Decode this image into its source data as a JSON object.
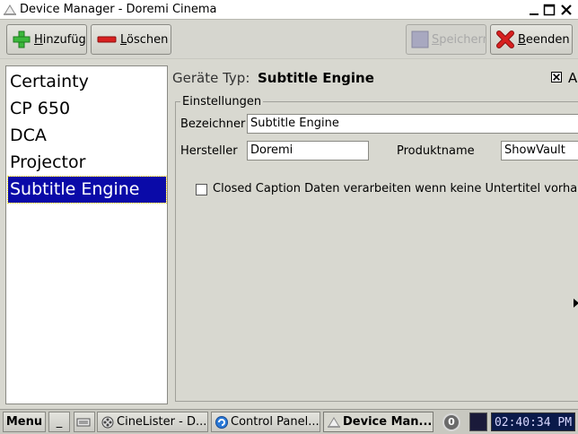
{
  "window": {
    "title": "Device Manager - Doremi Cinema"
  },
  "toolbar": {
    "add": {
      "prefix": "",
      "accel": "H",
      "rest": "inzufügen"
    },
    "delete": {
      "prefix": "",
      "accel": "L",
      "rest": "öschen"
    },
    "save": {
      "prefix": "",
      "accel": "S",
      "rest": "peichern"
    },
    "quit": {
      "prefix": "",
      "accel": "B",
      "rest": "eenden"
    }
  },
  "devices": {
    "items": [
      "Certainty",
      "CP 650",
      "DCA",
      "Projector",
      "Subtitle Engine"
    ],
    "selected_index": 4
  },
  "details": {
    "type_label": "Geräte Typ:",
    "type_value": "Subtitle Engine",
    "active_checkbox_checked": true,
    "active_label": "A",
    "group_title": "Einstellungen",
    "name_label": "Bezeichner",
    "name_value": "Subtitle Engine",
    "manufacturer_label": "Hersteller",
    "manufacturer_value": "Doremi",
    "product_label": "Produktname",
    "product_value": "ShowVault",
    "cc_checked": false,
    "cc_label": "Closed Caption Daten verarbeiten wenn keine Untertitel vorhand"
  },
  "taskbar": {
    "menu_label": "Menu",
    "minimize_label": "_",
    "tasks": [
      "CineLister - D...",
      "Control Panel...",
      "Device Man..."
    ],
    "notification_count": "0",
    "clock": "02:40:34 PM"
  },
  "colors": {
    "selection_bg": "#0a0aa8",
    "add_icon": "#3cb83c",
    "delete_icon": "#d82020",
    "quit_icon": "#d82020"
  }
}
